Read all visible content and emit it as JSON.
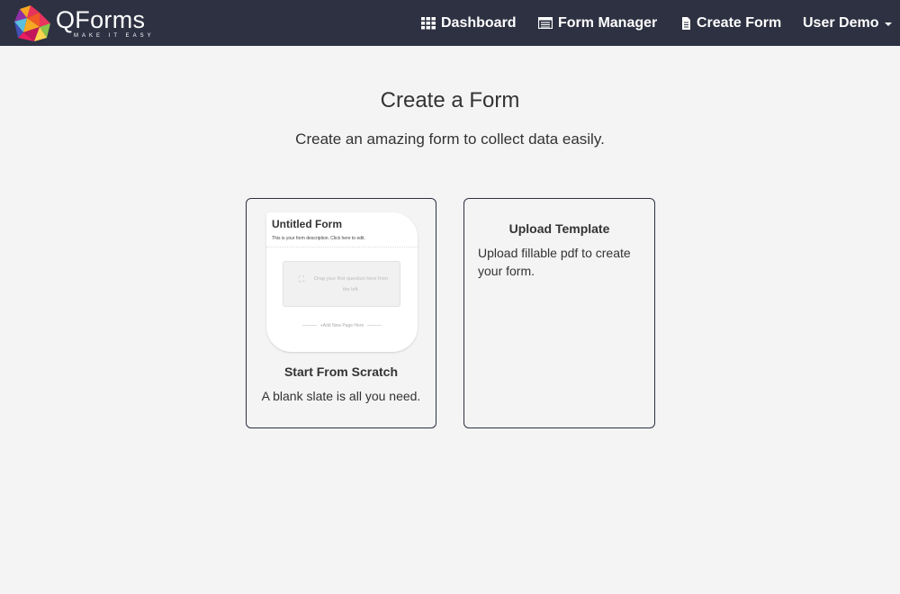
{
  "app": {
    "name": "QForms",
    "tagline": "MAKE IT EASY"
  },
  "nav": {
    "dashboard": {
      "label": "Dashboard",
      "icon": "grid-icon"
    },
    "form_manager": {
      "label": "Form Manager",
      "icon": "list-icon"
    },
    "create_form": {
      "label": "Create Form",
      "icon": "document-icon"
    },
    "user": {
      "label": "User Demo",
      "icon": "caret-down-icon"
    }
  },
  "main": {
    "title": "Create a Form",
    "subtitle": "Create an amazing form to collect data easily."
  },
  "cards": {
    "scratch": {
      "preview": {
        "title": "Untitled Form",
        "description": "This is your form description. Click here to edit.",
        "drop_text": "Drag your first question here from the left.",
        "add_page": "+Add New Page Here"
      },
      "title": "Start From Scratch",
      "description": "A blank slate is all you need."
    },
    "upload": {
      "title": "Upload Template",
      "description": "Upload fillable pdf to create your form."
    }
  },
  "colors": {
    "navbar": "#2d3142",
    "background": "#f4f4f4",
    "card_border": "#2d3142"
  }
}
